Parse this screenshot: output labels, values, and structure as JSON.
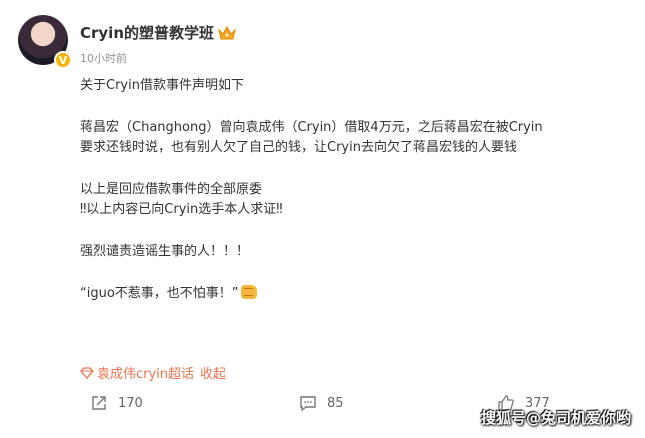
{
  "author": {
    "name": "Cryin的塑普教学班",
    "verified_badge": "V",
    "crown_icon": "crown-icon",
    "posted_time": "10小时前"
  },
  "content": {
    "lines": [
      "关于Cryin借款事件声明如下",
      "蒋昌宏（Changhong）曾向袁成伟（Cryin）借取4万元，之后蒋昌宏在被Cryin",
      "要求还钱时说，也有别人欠了自己的钱，让Cryin去向欠了蒋昌宏钱的人要钱",
      "以上是回应借款事件的全部原委",
      "‼以上内容已向Cryin选手本人求证‼",
      "强烈谴责造谣生事的人！！！",
      "“iguo不惹事，也不怕事！”"
    ],
    "end_emoji": "fist-icon"
  },
  "topic": {
    "label": "袁成伟cryin超话",
    "collected_label": "收起"
  },
  "actions": {
    "share_count": "170",
    "comment_count": "85",
    "like_count": "377"
  },
  "watermark": "搜狐号@兔司机爱你哟",
  "colors": {
    "topic": "#eb7350",
    "badge": "#f7b500",
    "text": "#333333",
    "muted": "#939393"
  }
}
